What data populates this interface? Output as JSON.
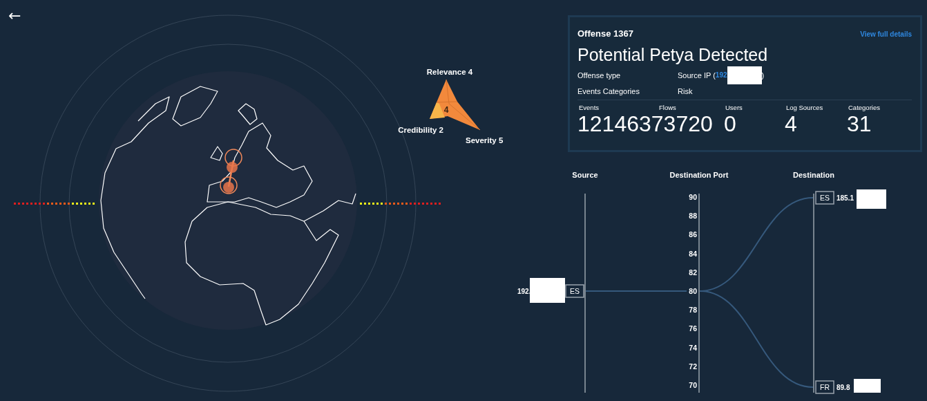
{
  "back_button": {
    "label": "←"
  },
  "risk_chart": {
    "labels": [
      "Relevance 4",
      "Credibility 2",
      "Severity 5"
    ],
    "magnitude": "4"
  },
  "offense": {
    "heading": "Offense 1367",
    "link": "View full details",
    "title": "Potential Petya Detected",
    "fields": [
      {
        "label": "Offense type",
        "value": "Source IP (",
        "link": "192",
        "redacted": true,
        "suffix": ")"
      },
      {
        "label": "Events Categories",
        "value": "Risk",
        "redacted": false
      }
    ],
    "stats": [
      {
        "label": "Events",
        "value": "12146373720"
      },
      {
        "label": "Flows"
      },
      {
        "label": "Users",
        "value": "0"
      },
      {
        "label": "Log Sources",
        "value": "4"
      },
      {
        "label": "Categories",
        "value": "31"
      }
    ]
  },
  "flow": {
    "headers": [
      "Source",
      "Destination Port",
      "Destination"
    ],
    "port_ticks": [
      "90",
      "88",
      "86",
      "84",
      "82",
      "80",
      "78",
      "76",
      "74",
      "72",
      "70"
    ],
    "source": {
      "ip": "192.",
      "country": "ES",
      "redacted": true
    },
    "destinations": [
      {
        "country": "ES",
        "ip": "185.1",
        "redacted": true
      },
      {
        "country": "FR",
        "ip": "89.8",
        "redacted": true
      }
    ]
  }
}
